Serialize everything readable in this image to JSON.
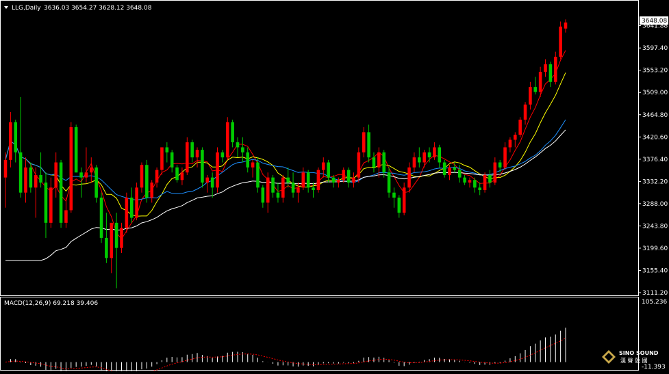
{
  "header": {
    "symbol_label": "LLG,Daily",
    "ohlc": "3636.03 3654.27 3628.12 3648.08"
  },
  "price_axis": {
    "current_price_label": "3648.08",
    "ticks": [
      "3641.88",
      "3597.40",
      "3553.20",
      "3509.00",
      "3464.80",
      "3420.60",
      "3376.40",
      "3332.20",
      "3288.00",
      "3243.80",
      "3199.60",
      "3155.40",
      "3111.20"
    ]
  },
  "macd": {
    "title": "MACD(12,26,9) 69.218 39.406",
    "axis_top": "105.236",
    "axis_bottom": "-11.393"
  },
  "watermark": {
    "brand": "SINO SOUND",
    "sub": "漢 聲 匯 國"
  },
  "colors": {
    "background": "#000000",
    "grid_border": "#ffffff",
    "up_candle": "#ff0000",
    "down_candle": "#00cc00",
    "ma5": "#ff0000",
    "ma10": "#ffff00",
    "ma20": "#1e90ff",
    "ma60": "#ffffff",
    "macd_hist": "#ffffff",
    "macd_signal": "#ff0000"
  },
  "chart_data": [
    {
      "type": "candlestick",
      "title": "LLG,Daily",
      "ylim": [
        3111.2,
        3652
      ],
      "ma_series": [
        "MA5",
        "MA10",
        "MA20",
        "MA60"
      ],
      "ohlc": [
        [
          3340,
          3390,
          3280,
          3375
        ],
        [
          3375,
          3470,
          3360,
          3450
        ],
        [
          3450,
          3455,
          3370,
          3390
        ],
        [
          3390,
          3500,
          3300,
          3310
        ],
        [
          3310,
          3380,
          3290,
          3360
        ],
        [
          3360,
          3370,
          3310,
          3320
        ],
        [
          3320,
          3360,
          3260,
          3345
        ],
        [
          3345,
          3390,
          3320,
          3330
        ],
        [
          3330,
          3350,
          3220,
          3250
        ],
        [
          3250,
          3340,
          3240,
          3320
        ],
        [
          3320,
          3390,
          3300,
          3370
        ],
        [
          3370,
          3375,
          3240,
          3250
        ],
        [
          3250,
          3300,
          3240,
          3275
        ],
        [
          3275,
          3450,
          3270,
          3440
        ],
        [
          3440,
          3445,
          3350,
          3350
        ],
        [
          3350,
          3360,
          3300,
          3340
        ],
        [
          3340,
          3400,
          3330,
          3350
        ],
        [
          3350,
          3380,
          3330,
          3360
        ],
        [
          3360,
          3365,
          3290,
          3300
        ],
        [
          3300,
          3310,
          3210,
          3220
        ],
        [
          3220,
          3270,
          3170,
          3180
        ],
        [
          3180,
          3250,
          3150,
          3250
        ],
        [
          3250,
          3270,
          3120,
          3200
        ],
        [
          3200,
          3250,
          3190,
          3240
        ],
        [
          3240,
          3310,
          3230,
          3300
        ],
        [
          3300,
          3320,
          3250,
          3260
        ],
        [
          3260,
          3330,
          3255,
          3320
        ],
        [
          3320,
          3370,
          3310,
          3365
        ],
        [
          3365,
          3375,
          3290,
          3300
        ],
        [
          3300,
          3335,
          3290,
          3330
        ],
        [
          3330,
          3360,
          3320,
          3355
        ],
        [
          3355,
          3400,
          3345,
          3400
        ],
        [
          3400,
          3410,
          3370,
          3390
        ],
        [
          3390,
          3395,
          3350,
          3360
        ],
        [
          3360,
          3365,
          3330,
          3335
        ],
        [
          3335,
          3360,
          3325,
          3350
        ],
        [
          3350,
          3420,
          3345,
          3410
        ],
        [
          3410,
          3415,
          3370,
          3380
        ],
        [
          3380,
          3400,
          3360,
          3395
        ],
        [
          3395,
          3400,
          3320,
          3330
        ],
        [
          3330,
          3345,
          3310,
          3340
        ],
        [
          3340,
          3350,
          3300,
          3320
        ],
        [
          3320,
          3400,
          3310,
          3390
        ],
        [
          3390,
          3395,
          3370,
          3380
        ],
        [
          3380,
          3460,
          3375,
          3450
        ],
        [
          3450,
          3455,
          3400,
          3410
        ],
        [
          3410,
          3420,
          3380,
          3400
        ],
        [
          3400,
          3420,
          3370,
          3390
        ],
        [
          3390,
          3400,
          3350,
          3360
        ],
        [
          3360,
          3375,
          3340,
          3370
        ],
        [
          3370,
          3380,
          3310,
          3320
        ],
        [
          3320,
          3325,
          3280,
          3290
        ],
        [
          3290,
          3350,
          3270,
          3340
        ],
        [
          3340,
          3345,
          3300,
          3310
        ],
        [
          3310,
          3330,
          3290,
          3300
        ],
        [
          3300,
          3345,
          3290,
          3340
        ],
        [
          3340,
          3360,
          3320,
          3330
        ],
        [
          3330,
          3350,
          3300,
          3310
        ],
        [
          3310,
          3330,
          3290,
          3320
        ],
        [
          3320,
          3360,
          3315,
          3350
        ],
        [
          3350,
          3355,
          3310,
          3320
        ],
        [
          3320,
          3330,
          3300,
          3315
        ],
        [
          3315,
          3360,
          3310,
          3355
        ],
        [
          3355,
          3380,
          3340,
          3370
        ],
        [
          3370,
          3375,
          3330,
          3340
        ],
        [
          3340,
          3345,
          3320,
          3330
        ],
        [
          3330,
          3340,
          3320,
          3335
        ],
        [
          3335,
          3360,
          3330,
          3355
        ],
        [
          3355,
          3360,
          3320,
          3330
        ],
        [
          3330,
          3350,
          3320,
          3340
        ],
        [
          3340,
          3400,
          3330,
          3390
        ],
        [
          3390,
          3440,
          3380,
          3430
        ],
        [
          3430,
          3445,
          3370,
          3380
        ],
        [
          3380,
          3390,
          3350,
          3360
        ],
        [
          3360,
          3400,
          3340,
          3390
        ],
        [
          3390,
          3395,
          3340,
          3350
        ],
        [
          3350,
          3360,
          3300,
          3310
        ],
        [
          3310,
          3320,
          3280,
          3300
        ],
        [
          3300,
          3305,
          3260,
          3270
        ],
        [
          3270,
          3330,
          3265,
          3320
        ],
        [
          3320,
          3370,
          3310,
          3360
        ],
        [
          3360,
          3390,
          3350,
          3380
        ],
        [
          3380,
          3400,
          3360,
          3370
        ],
        [
          3370,
          3395,
          3360,
          3390
        ],
        [
          3390,
          3400,
          3370,
          3380
        ],
        [
          3380,
          3410,
          3375,
          3400
        ],
        [
          3400,
          3405,
          3360,
          3370
        ],
        [
          3370,
          3375,
          3340,
          3345
        ],
        [
          3345,
          3365,
          3335,
          3360
        ],
        [
          3360,
          3370,
          3350,
          3355
        ],
        [
          3355,
          3365,
          3330,
          3340
        ],
        [
          3340,
          3345,
          3325,
          3330
        ],
        [
          3330,
          3340,
          3320,
          3335
        ],
        [
          3335,
          3340,
          3310,
          3320
        ],
        [
          3320,
          3330,
          3305,
          3315
        ],
        [
          3315,
          3350,
          3310,
          3345
        ],
        [
          3345,
          3355,
          3320,
          3330
        ],
        [
          3330,
          3380,
          3325,
          3370
        ],
        [
          3370,
          3375,
          3350,
          3360
        ],
        [
          3360,
          3410,
          3355,
          3400
        ],
        [
          3400,
          3420,
          3390,
          3415
        ],
        [
          3415,
          3430,
          3400,
          3425
        ],
        [
          3425,
          3460,
          3420,
          3455
        ],
        [
          3455,
          3490,
          3445,
          3485
        ],
        [
          3485,
          3530,
          3475,
          3520
        ],
        [
          3520,
          3540,
          3505,
          3510
        ],
        [
          3510,
          3560,
          3500,
          3550
        ],
        [
          3550,
          3575,
          3540,
          3565
        ],
        [
          3565,
          3570,
          3520,
          3530
        ],
        [
          3530,
          3590,
          3525,
          3580
        ],
        [
          3580,
          3650,
          3575,
          3640
        ],
        [
          3636.03,
          3654.27,
          3628.12,
          3648.08
        ]
      ]
    },
    {
      "type": "bar",
      "title": "MACD(12,26,9) 69.218 39.406",
      "macd_value": 69.218,
      "signal_value": 39.406,
      "ylim": [
        -11.393,
        105.236
      ]
    }
  ]
}
